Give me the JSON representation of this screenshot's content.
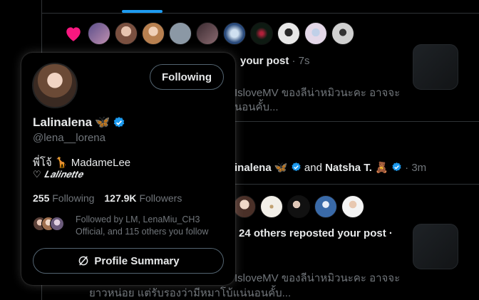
{
  "timeline": {
    "likes": {
      "avatar_colors": [
        "#7a6a9c",
        "#b07a6a",
        "#c9976f",
        "#8a96a6",
        "#5c4a52",
        "#4a6a8a",
        "#1f2a22",
        "#d8d8d8",
        "#c7bcc8",
        "#9a9a9a"
      ]
    },
    "notif1": {
      "text": "your post",
      "time": "· 7s",
      "snippet_line1": "IsloveMV ของลีน่าหมิวนะคะ อาจจะ",
      "snippet_line2": "นอนคั้บ..."
    },
    "notif2": {
      "name_fragment": "inalena",
      "emoji1": "🦋",
      "and_text": "and",
      "second_name": "Natsha T.",
      "emoji2": "🧸",
      "time": "· 3m"
    },
    "notif3": {
      "avatar_colors": [
        "#c8a89a",
        "#e8e4dc",
        "#1a1a1a",
        "#5a7aa0",
        "#e8e8e8"
      ],
      "text": "24 others reposted your post ·",
      "snippet_line1": "IsloveMV ของลีน่าหมิวนะคะ อาจจะ",
      "snippet_line2": "ยาวหน่อย แต่รับรองว่ามีหมาโบ้แน่นอนคั้บ..."
    }
  },
  "card": {
    "follow_button": "Following",
    "name": "Lalinalena",
    "name_emoji": "🦋",
    "handle": "@lena__lorena",
    "bio_line1": "พี่โจ้ 🦒 MadameLee",
    "bio_line2": "♡ 𝑳𝒂𝒍𝒊𝒏𝒆𝒕𝒕𝒆",
    "following_count": "255",
    "following_label": "Following",
    "followers_count": "127.9K",
    "followers_label": "Followers",
    "followed_by": "Followed by LM, LenaMiu_CH3 Official, and 115 others you follow",
    "summary_button": "Profile Summary",
    "accent": "#1d9bf0",
    "heart_color": "#f91880"
  }
}
